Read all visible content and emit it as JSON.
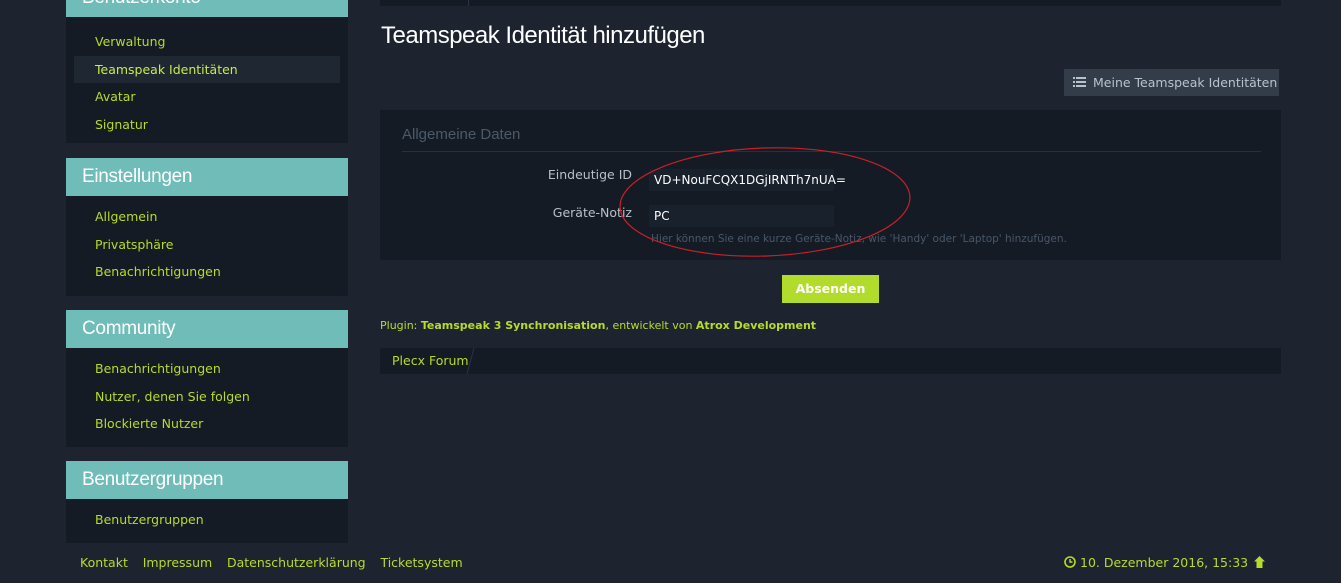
{
  "sidebar": {
    "account": {
      "title": "Benutzerkonto",
      "items": [
        {
          "label": "Verwaltung"
        },
        {
          "label": "Teamspeak Identitäten"
        },
        {
          "label": "Avatar"
        },
        {
          "label": "Signatur"
        }
      ]
    },
    "settings": {
      "title": "Einstellungen",
      "items": [
        {
          "label": "Allgemein"
        },
        {
          "label": "Privatsphäre"
        },
        {
          "label": "Benachrichtigungen"
        }
      ]
    },
    "community": {
      "title": "Community",
      "items": [
        {
          "label": "Benachrichtigungen"
        },
        {
          "label": "Nutzer, denen Sie folgen"
        },
        {
          "label": "Blockierte Nutzer"
        }
      ]
    },
    "groups": {
      "title": "Benutzergruppen",
      "items": [
        {
          "label": "Benutzergruppen"
        }
      ]
    }
  },
  "main": {
    "title": "Teamspeak Identität hinzufügen",
    "my_ids_button": "Meine Teamspeak Identitäten",
    "section_title": "Allgemeine Daten",
    "fields": {
      "uid_label": "Eindeutige ID",
      "uid_value": "VD+NouFCQX1DGjIRNTh7nUA=",
      "note_label": "Geräte-Notiz",
      "note_value": "PC",
      "note_help": "Hier können Sie eine kurze Geräte-Notiz, wie 'Handy' oder 'Laptop' hinzufügen."
    },
    "submit_label": "Absenden",
    "plugin": {
      "prefix": "Plugin: ",
      "name": "Teamspeak 3 Synchronisation",
      "middle": ", entwickelt von ",
      "author": "Atrox Development"
    },
    "breadcrumb": "Plecx Forum"
  },
  "footer": {
    "links": [
      "Kontakt",
      "Impressum",
      "Datenschutzerklärung",
      "Ticketsystem"
    ],
    "timestamp": "10. Dezember 2016, 15:33"
  },
  "colors": {
    "background": "#1d2430",
    "panel": "#141b24",
    "accent": "#b6dc2a",
    "box_header": "#6fbcb8",
    "annotation": "#c8202a"
  },
  "icons": [
    "list-icon",
    "clock-icon",
    "arrow-up-icon"
  ]
}
